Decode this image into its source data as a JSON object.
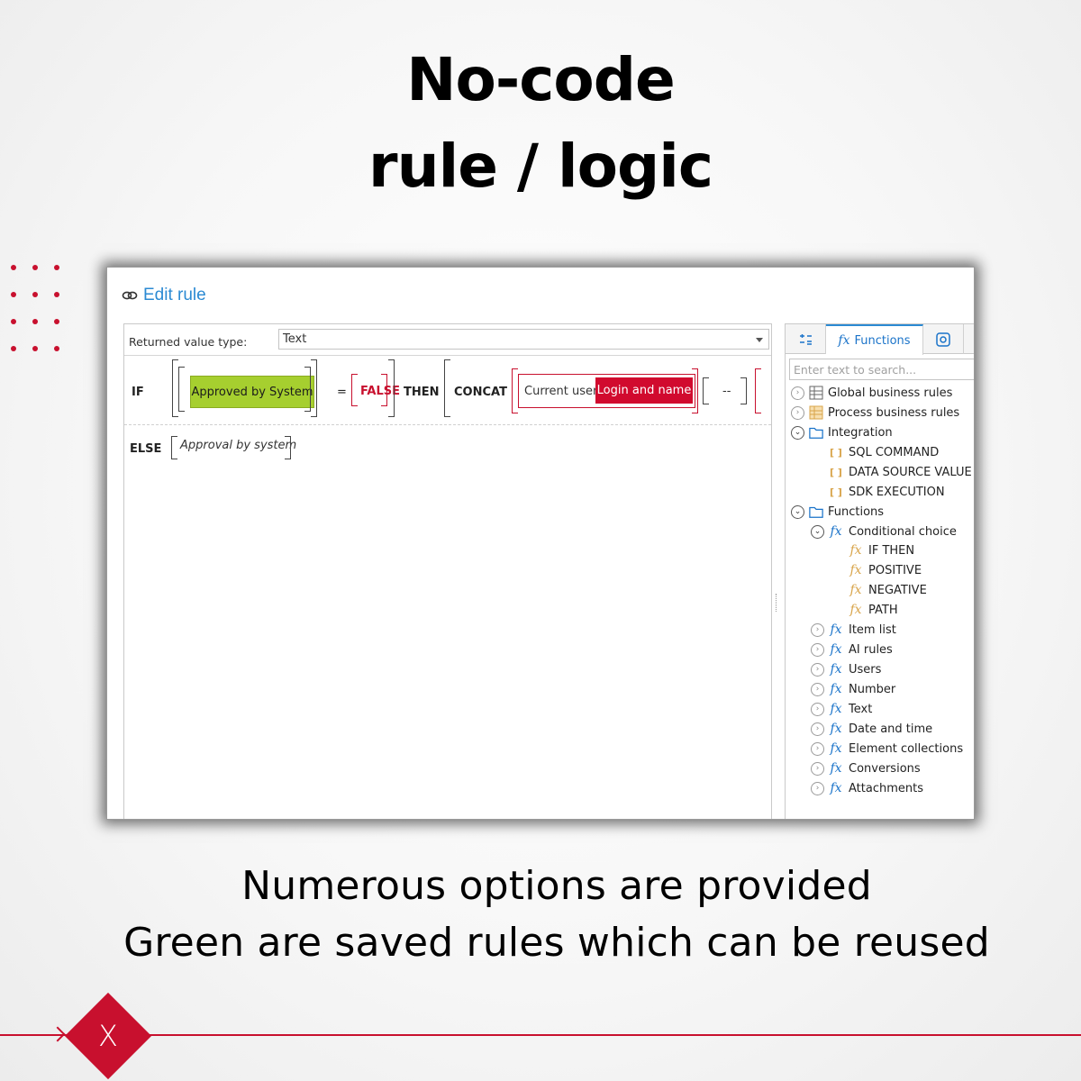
{
  "headline": {
    "line1": "No-code",
    "line2": "rule / logic"
  },
  "caption": {
    "line1": "Numerous options are provided",
    "line2": "Green are saved rules which can be reused"
  },
  "brand": {
    "accent": "#c8102e",
    "logo_glyph": "X"
  },
  "editor": {
    "title": "Edit rule",
    "returned_value_label": "Returned value type:",
    "returned_value": "Text",
    "expression": {
      "if": "IF",
      "saved_rule": "Approved by System",
      "equals": "=",
      "false": "FALSE",
      "then": "THEN",
      "concat": "CONCAT",
      "current_user": "Current user",
      "login_and_name": "Login and name",
      "separator": "--",
      "else": "ELSE",
      "else_value": "Approval by system"
    },
    "colors": {
      "saved_rule": "#a6cf2f",
      "function_chip": "#d10a2e",
      "link": "#2b8ad3"
    }
  },
  "panel": {
    "tabs": [
      {
        "icon": "variables-icon",
        "label": ""
      },
      {
        "icon": "fx-icon",
        "label": "Functions"
      },
      {
        "icon": "at-sign-icon",
        "label": ""
      }
    ],
    "search_placeholder": "Enter text to search...",
    "tree": [
      {
        "label": "Global business rules"
      },
      {
        "label": "Process business rules"
      },
      {
        "label": "Integration"
      },
      {
        "label": "SQL COMMAND"
      },
      {
        "label": "DATA SOURCE VALUE"
      },
      {
        "label": "SDK EXECUTION"
      },
      {
        "label": "Functions"
      },
      {
        "label": "Conditional choice"
      },
      {
        "label": "IF THEN"
      },
      {
        "label": "POSITIVE"
      },
      {
        "label": "NEGATIVE"
      },
      {
        "label": "PATH"
      },
      {
        "label": "Item list"
      },
      {
        "label": "AI rules"
      },
      {
        "label": "Users"
      },
      {
        "label": "Number"
      },
      {
        "label": "Text"
      },
      {
        "label": "Date and time"
      },
      {
        "label": "Element collections"
      },
      {
        "label": "Conversions"
      },
      {
        "label": "Attachments"
      }
    ]
  }
}
